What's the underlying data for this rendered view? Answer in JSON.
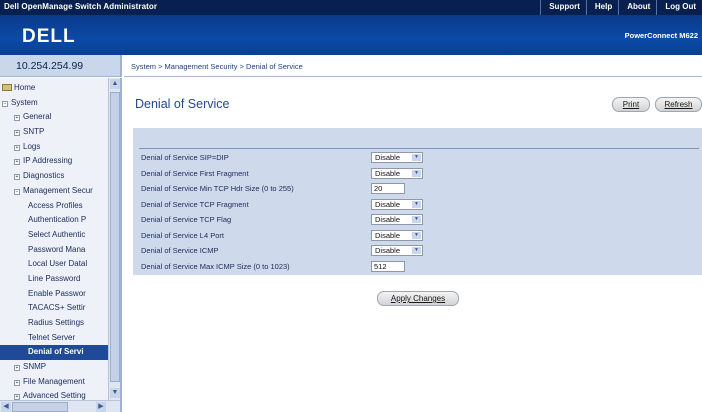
{
  "app": {
    "title": "Dell OpenManage Switch Administrator"
  },
  "topnav": [
    "Support",
    "Help",
    "About",
    "Log Out"
  ],
  "banner": {
    "logo": "DELL",
    "product": "PowerConnect M622"
  },
  "ip_address": "10.254.254.99",
  "breadcrumb": "System > Management Security > Denial of Service",
  "sidebar": {
    "items": [
      {
        "label": "Home",
        "icon": "folder-icon"
      },
      {
        "label": "System",
        "icon": "collapse-icon"
      },
      {
        "label": "General",
        "icon": "expand-icon"
      },
      {
        "label": "SNTP",
        "icon": "expand-icon"
      },
      {
        "label": "Logs",
        "icon": "expand-icon"
      },
      {
        "label": "IP Addressing",
        "icon": "expand-icon"
      },
      {
        "label": "Diagnostics",
        "icon": "expand-icon"
      },
      {
        "label": "Management Secur",
        "icon": "collapse-icon"
      },
      {
        "label": "Access Profiles"
      },
      {
        "label": "Authentication P"
      },
      {
        "label": "Select Authentic"
      },
      {
        "label": "Password Mana"
      },
      {
        "label": "Local User Datal"
      },
      {
        "label": "Line Password"
      },
      {
        "label": "Enable Passwor"
      },
      {
        "label": "TACACS+ Settir"
      },
      {
        "label": "Radius Settings"
      },
      {
        "label": "Telnet Server"
      },
      {
        "label": "Denial of Servi",
        "selected": true
      },
      {
        "label": "SNMP",
        "icon": "expand-icon"
      },
      {
        "label": "File Management",
        "icon": "expand-icon"
      },
      {
        "label": "Advanced Setting",
        "icon": "expand-icon"
      }
    ]
  },
  "page": {
    "title": "Denial of Service",
    "print_label": "Print",
    "refresh_label": "Refresh",
    "apply_label": "Apply Changes"
  },
  "settings": [
    {
      "label": "Denial of Service SIP=DIP",
      "type": "select",
      "value": "Disable"
    },
    {
      "label": "Denial of Service First Fragment",
      "type": "select",
      "value": "Disable"
    },
    {
      "label": "Denial of Service Min TCP Hdr Size (0 to 255)",
      "type": "input",
      "value": "20"
    },
    {
      "label": "Denial of Service TCP Fragment",
      "type": "select",
      "value": "Disable"
    },
    {
      "label": "Denial of Service TCP Flag",
      "type": "select",
      "value": "Disable"
    },
    {
      "label": "Denial of Service L4 Port",
      "type": "select",
      "value": "Disable"
    },
    {
      "label": "Denial of Service ICMP",
      "type": "select",
      "value": "Disable"
    },
    {
      "label": "Denial of Service Max ICMP Size (0 to 1023)",
      "type": "input",
      "value": "512"
    }
  ],
  "colors": {
    "topbar": "#08204f",
    "banner": "#0b4aa6",
    "panel": "#cfd9ec",
    "selected_item": "#1e4a97",
    "title": "#224a8c"
  }
}
